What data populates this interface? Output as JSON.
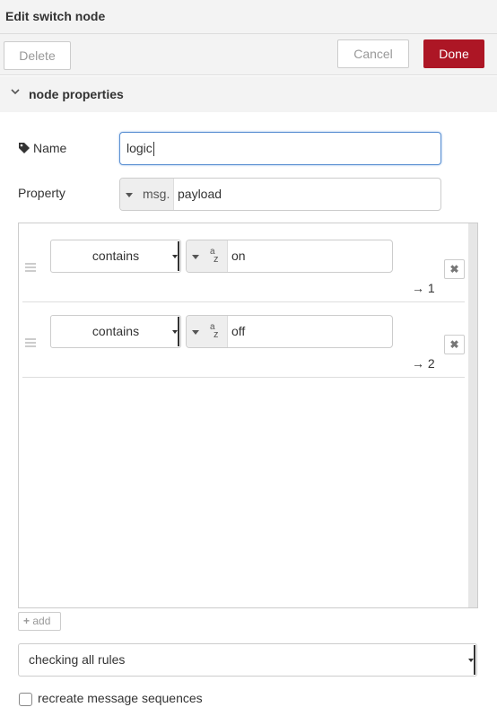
{
  "dialog": {
    "title": "Edit switch node"
  },
  "toolbar": {
    "delete_label": "Delete",
    "cancel_label": "Cancel",
    "done_label": "Done"
  },
  "section": {
    "label": "node properties"
  },
  "name_field": {
    "label": "Name",
    "value": "logic",
    "icon": "tag-icon"
  },
  "property_field": {
    "label": "Property",
    "type_prefix": "msg.",
    "value": "payload"
  },
  "rules": [
    {
      "operator": "contains",
      "value_type": "string",
      "value": "on",
      "output": "→ 1"
    },
    {
      "operator": "contains",
      "value_type": "string",
      "value": "off",
      "output": "→ 2"
    }
  ],
  "add_button": {
    "label": "add"
  },
  "checking": {
    "value": "checking all rules"
  },
  "recreate_sequences": {
    "label": "recreate message sequences",
    "checked": false
  },
  "colors": {
    "done_button": "#ad1625",
    "focus_border": "#5b90d2",
    "toolbar_bg": "#f3f3f3"
  }
}
